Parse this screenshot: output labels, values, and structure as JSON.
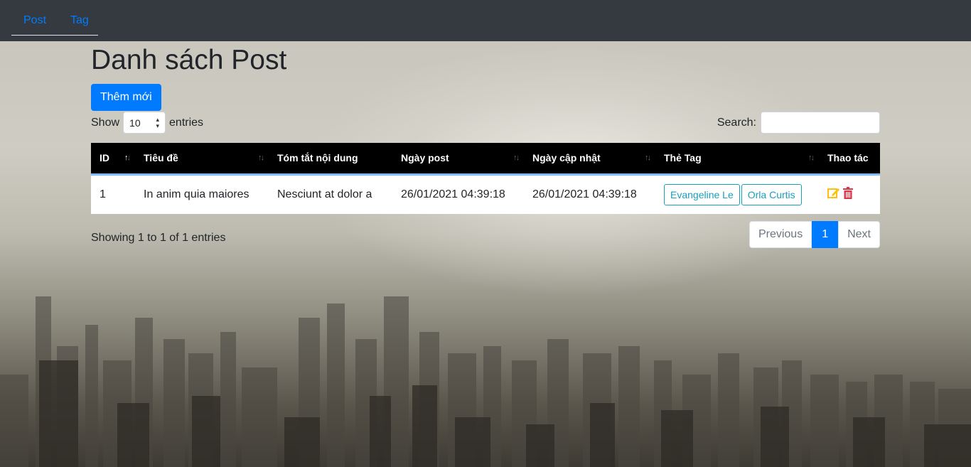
{
  "nav": {
    "items": [
      {
        "label": "Post"
      },
      {
        "label": "Tag"
      }
    ]
  },
  "page": {
    "title": "Danh sách Post",
    "add_button": "Thêm mới"
  },
  "length_control": {
    "prefix": "Show",
    "value": "10",
    "suffix": "entries"
  },
  "search": {
    "label": "Search:",
    "value": ""
  },
  "table": {
    "columns": [
      "ID",
      "Tiêu đề",
      "Tóm tắt nội dung",
      "Ngày post",
      "Ngày cập nhật",
      "Thẻ Tag",
      "Thao tác"
    ],
    "rows": [
      {
        "id": "1",
        "title": "In anim quia maiores",
        "summary": "Nesciunt at dolor a",
        "posted": "26/01/2021 04:39:18",
        "updated": "26/01/2021 04:39:18",
        "tags": [
          "Evangeline Le",
          "Orla Curtis"
        ],
        "actions": [
          "edit-icon",
          "trash-icon"
        ]
      }
    ]
  },
  "info": "Showing 1 to 1 of 1 entries",
  "pagination": {
    "previous": "Previous",
    "current": "1",
    "next": "Next"
  },
  "colors": {
    "primary": "#007bff",
    "navbar": "#343a40",
    "header": "#000000",
    "tag": "#17a2b8",
    "edit": "#ffc107",
    "delete": "#dc3545"
  }
}
